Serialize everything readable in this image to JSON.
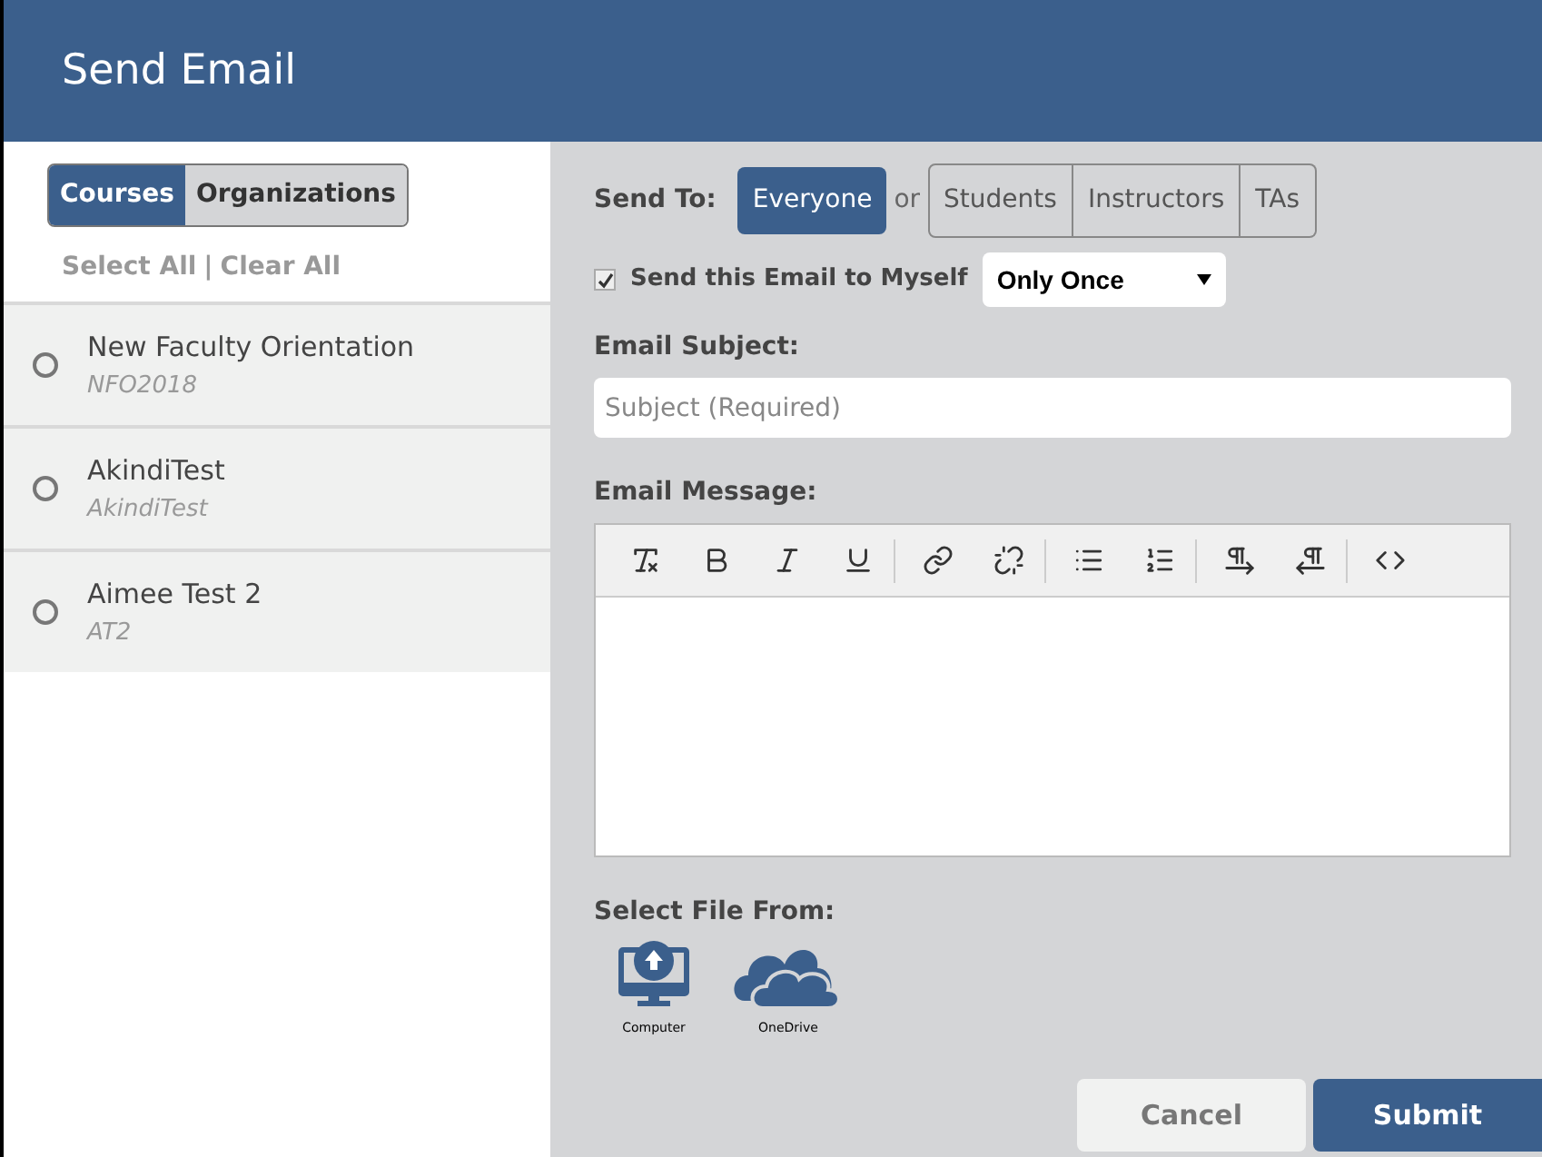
{
  "header": {
    "title": "Send Email"
  },
  "source_tabs": [
    {
      "label": "Courses",
      "selected": true
    },
    {
      "label": "Organizations",
      "selected": false
    }
  ],
  "selection_links": {
    "select_all": "Select All",
    "separator": "|",
    "clear_all": "Clear All"
  },
  "courses": [
    {
      "name": "New Faculty Orientation",
      "code": "NFO2018",
      "selected": false
    },
    {
      "name": "AkindiTest",
      "code": "AkindiTest",
      "selected": false
    },
    {
      "name": "Aimee Test 2",
      "code": "AT2",
      "selected": false
    }
  ],
  "send_to": {
    "label": "Send To:",
    "everyone": {
      "label": "Everyone",
      "selected": true
    },
    "or": "or",
    "groups": [
      {
        "label": "Students",
        "selected": false
      },
      {
        "label": "Instructors",
        "selected": false
      },
      {
        "label": "TAs",
        "selected": false
      }
    ]
  },
  "send_to_myself": {
    "label": "Send this Email to Myself",
    "checked": true,
    "frequency": "Only Once"
  },
  "subject": {
    "label": "Email Subject:",
    "placeholder": "Subject (Required)"
  },
  "message": {
    "label": "Email Message:"
  },
  "file_sources": {
    "label": "Select File From:",
    "items": [
      {
        "kind": "computer",
        "label": "Computer"
      },
      {
        "kind": "cloud",
        "label": "OneDrive"
      }
    ]
  },
  "buttons": {
    "cancel": "Cancel",
    "submit": "Submit"
  }
}
